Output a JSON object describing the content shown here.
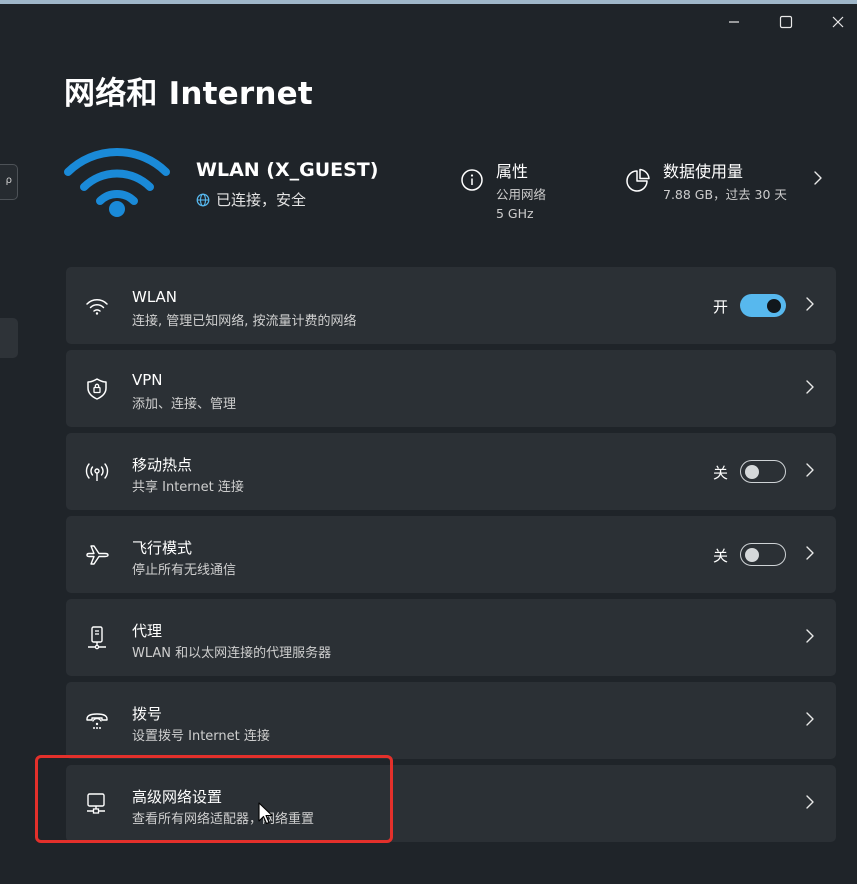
{
  "window": {
    "title": "网络和 Internet",
    "controls": [
      "minimize",
      "maximize",
      "close"
    ]
  },
  "sidebar_fragment": {
    "search_glyph": "ρ"
  },
  "connection": {
    "name": "WLAN (X_GUEST)",
    "status": "已连接，安全",
    "icon": "wifi-icon"
  },
  "properties": {
    "title": "属性",
    "line1": "公用网络",
    "line2": "5 GHz",
    "icon": "info-icon"
  },
  "data_usage": {
    "title": "数据使用量",
    "value": "7.88 GB，过去 30 天",
    "icon": "pie-chart-icon"
  },
  "settings": [
    {
      "id": "wlan",
      "title": "WLAN",
      "subtitle": "连接, 管理已知网络, 按流量计费的网络",
      "icon": "wifi-icon",
      "toggle": true,
      "toggle_on": true,
      "state_label": "开"
    },
    {
      "id": "vpn",
      "title": "VPN",
      "subtitle": "添加、连接、管理",
      "icon": "shield-icon",
      "toggle": false
    },
    {
      "id": "hotspot",
      "title": "移动热点",
      "subtitle": "共享 Internet 连接",
      "icon": "hotspot-icon",
      "toggle": true,
      "toggle_on": false,
      "state_label": "关"
    },
    {
      "id": "airplane",
      "title": "飞行模式",
      "subtitle": "停止所有无线通信",
      "icon": "airplane-icon",
      "toggle": true,
      "toggle_on": false,
      "state_label": "关"
    },
    {
      "id": "proxy",
      "title": "代理",
      "subtitle": "WLAN 和以太网连接的代理服务器",
      "icon": "proxy-icon",
      "toggle": false
    },
    {
      "id": "dialup",
      "title": "拨号",
      "subtitle": "设置拨号 Internet 连接",
      "icon": "dialup-icon",
      "toggle": false
    },
    {
      "id": "advanced",
      "title": "高级网络设置",
      "subtitle": "查看所有网络适配器，网络重置",
      "icon": "network-adapter-icon",
      "toggle": false
    }
  ],
  "colors": {
    "background": "#1f2429",
    "card": "#2b3035",
    "accent": "#57b8ee",
    "wifi_blue": "#1a8ad8",
    "highlight": "#e3302b"
  }
}
